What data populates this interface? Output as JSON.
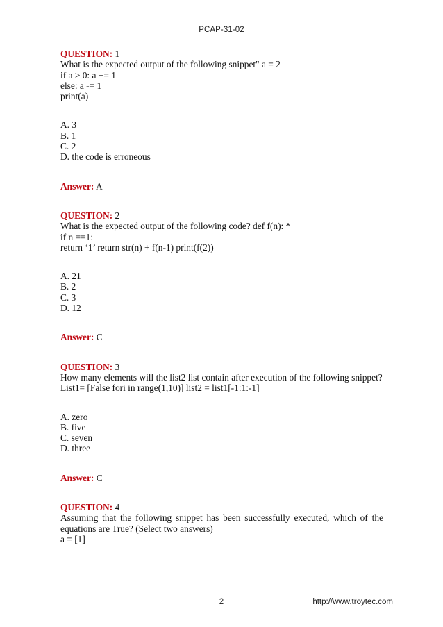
{
  "header": {
    "exam_code": "PCAP-31-02"
  },
  "footer": {
    "page_number": "2",
    "url": "http://www.troytec.com"
  },
  "labels": {
    "question_keyword": "QUESTION:",
    "answer_keyword": "Answer:"
  },
  "colors": {
    "heading_red": "#bf0a14",
    "body_text": "#111111",
    "page_background": "#ffffff"
  },
  "questions": [
    {
      "number": "1",
      "body_lines": [
        "What is the expected output of the following snippet\" a = 2",
        "if a > 0: a += 1",
        "else: a -= 1",
        "print(a)"
      ],
      "options": [
        "A. 3",
        "B. 1",
        "C. 2",
        "D. the code is erroneous"
      ],
      "answer": "A"
    },
    {
      "number": "2",
      "body_lines": [
        "What is the expected output of the following code? def f(n): *",
        "if n ==1:",
        "return ‘1’ return str(n) + f(n-1) print(f(2))"
      ],
      "options": [
        "A. 21",
        "B. 2",
        "C. 3",
        "D. 12"
      ],
      "answer": "C"
    },
    {
      "number": "3",
      "body_lines": [
        "How many elements will the list2 list contain after execution of the following snippet?",
        "List1= [False fori in range(1,10)] list2 = list1[-1:1:-1]"
      ],
      "options": [
        "A. zero",
        "B. five",
        "C. seven",
        "D. three"
      ],
      "answer": "C"
    },
    {
      "number": "4",
      "justified_paragraph": "Assuming that the following snippet has been successfully executed, which of the equations are True? (Select two answers)",
      "body_lines": [
        "a = [1]"
      ],
      "options": [],
      "answer": null
    }
  ]
}
